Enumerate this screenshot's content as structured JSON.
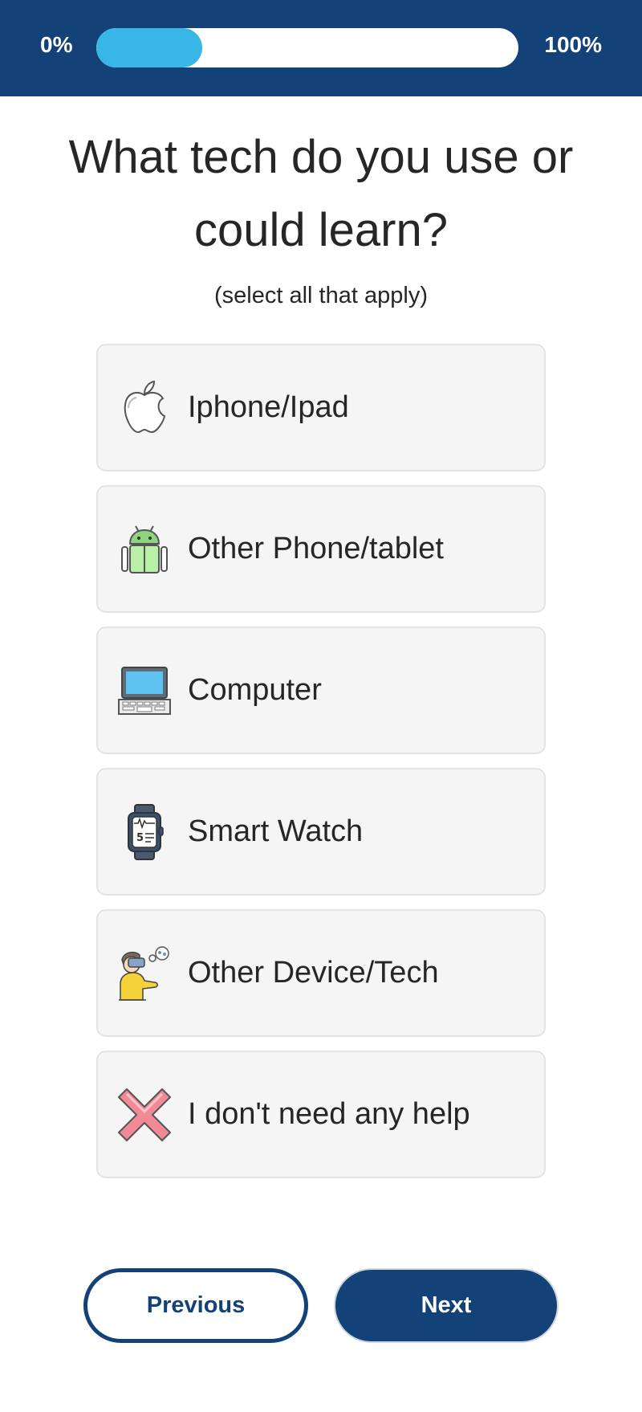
{
  "progress": {
    "start_label": "0%",
    "end_label": "100%",
    "value_percent": 25
  },
  "question": {
    "title": "What tech do you use or could learn?",
    "subtitle": "(select all that apply)"
  },
  "options": [
    {
      "label": "Iphone/Ipad",
      "icon": "apple-icon"
    },
    {
      "label": "Other Phone/tablet",
      "icon": "android-icon"
    },
    {
      "label": "Computer",
      "icon": "laptop-icon"
    },
    {
      "label": "Smart Watch",
      "icon": "smartwatch-icon"
    },
    {
      "label": "Other Device/Tech",
      "icon": "vr-headset-person-icon"
    },
    {
      "label": "I don't need any help",
      "icon": "red-x-icon"
    }
  ],
  "nav": {
    "previous_label": "Previous",
    "next_label": "Next"
  },
  "colors": {
    "brand_navy": "#124278",
    "progress_fill": "#38b6e6",
    "option_bg": "#f5f5f5"
  }
}
